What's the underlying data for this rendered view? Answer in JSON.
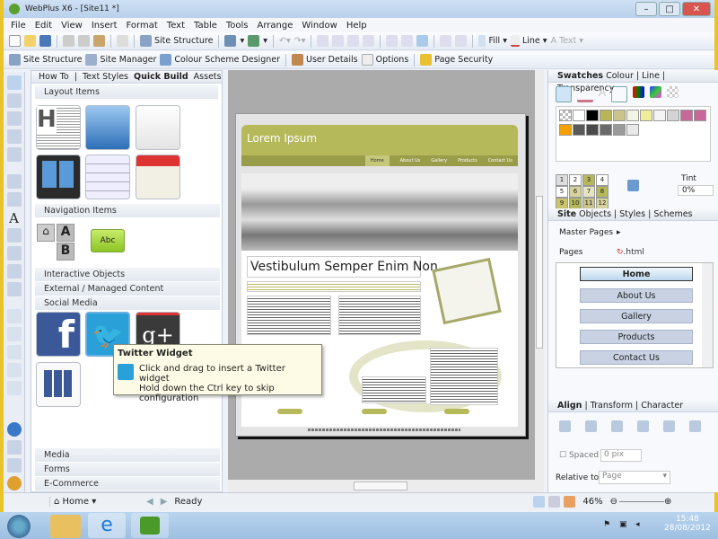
{
  "window": {
    "title": "WebPlus X6 - [Site11 *]"
  },
  "menu": [
    "File",
    "Edit",
    "View",
    "Insert",
    "Format",
    "Text",
    "Table",
    "Tools",
    "Arrange",
    "Window",
    "Help"
  ],
  "toolbar1": {
    "site_structure": "Site Structure",
    "fill": "Fill",
    "line": "Line",
    "text": "Text"
  },
  "toolbar2": {
    "site_structure": "Site Structure",
    "site_manager": "Site Manager",
    "colour_scheme": "Colour Scheme Designer",
    "user_details": "User Details",
    "options": "Options",
    "page_security": "Page Security"
  },
  "left_panel": {
    "tabs": [
      "How To",
      "Text Styles",
      "Quick Build",
      "Assets"
    ],
    "active_tab": "Quick Build",
    "sections": {
      "layout": "Layout Items",
      "navigation": "Navigation Items",
      "interactive": "Interactive Objects",
      "external": "External / Managed Content",
      "social": "Social Media",
      "media": "Media",
      "forms": "Forms",
      "ecommerce": "E-Commerce"
    },
    "nav_button_label": "Abc",
    "nav_ab": [
      "A",
      "B"
    ]
  },
  "tooltip": {
    "title": "Twitter Widget",
    "line1": "Click and drag to insert a Twitter widget",
    "line2": "Hold down the Ctrl key to skip configuration"
  },
  "webpage": {
    "site_title": "Lorem Ipsum",
    "nav": [
      "Home",
      "About Us",
      "Gallery",
      "Products",
      "Contact Us"
    ],
    "heading": "Vestibulum Semper Enim Non"
  },
  "right_panel": {
    "swatch_tabs": [
      "Swatches",
      "Colour",
      "Line",
      "Transparency"
    ],
    "swatch_colors": [
      "#ffffff",
      "#000000",
      "#b9b35a",
      "#c8c48a",
      "#f4f4e6",
      "#eeee9a",
      "#f4f4f4",
      "#d4d4d4",
      "#c8679a",
      "#c8679a",
      "#f6a000",
      "#5a5a5a",
      "#4a4a4a",
      "#6a6a6a",
      "#9a9a9a",
      "#e9e9e9"
    ],
    "scheme_numbers": [
      "1",
      "2",
      "3",
      "4",
      "5",
      "6",
      "7",
      "8",
      "9",
      "10",
      "11",
      "12"
    ],
    "tint_label": "Tint",
    "tint_value": "0%",
    "site_tabs": [
      "Site",
      "Objects",
      "Styles",
      "Schemes"
    ],
    "master_pages": "Master Pages",
    "pages_label": "Pages",
    "html_label": ".html",
    "pages": [
      "Home",
      "About Us",
      "Gallery",
      "Products",
      "Contact Us"
    ],
    "align_tabs": [
      "Align",
      "Transform",
      "Character"
    ],
    "spaced_label": "Spaced",
    "spaced_value": "0 pix",
    "relative_label": "Relative to:",
    "relative_value": "Page"
  },
  "status": {
    "page": "Home",
    "text": "Ready",
    "zoom": "46%"
  },
  "taskbar": {
    "time": "15:48",
    "date": "28/08/2012"
  },
  "colors": {
    "accent": "#b5b95a",
    "window_border": "#e8c32a"
  }
}
